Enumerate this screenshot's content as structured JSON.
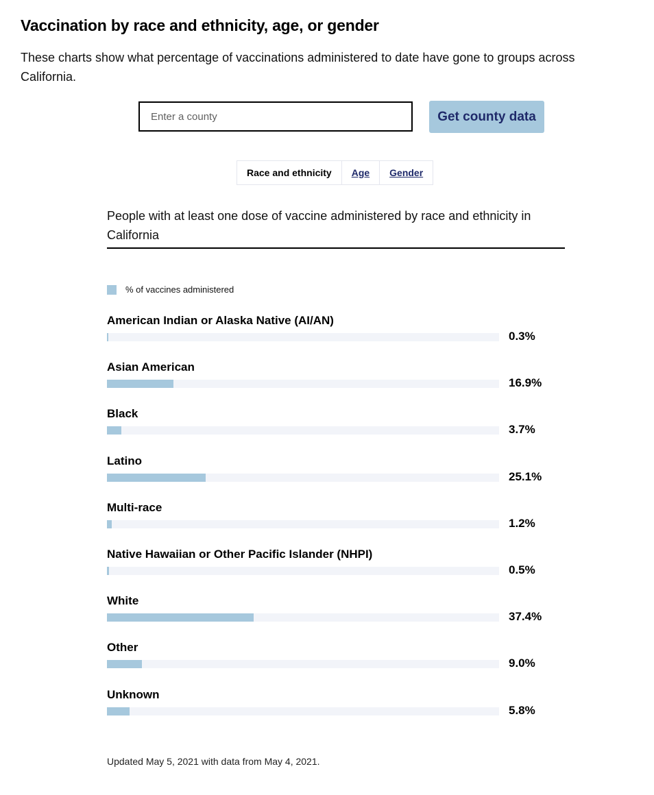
{
  "page": {
    "heading": "Vaccination by race and ethnicity, age, or gender",
    "intro": "These charts show what percentage of vaccinations administered to date have gone to groups across California."
  },
  "search": {
    "placeholder": "Enter a county",
    "value": "",
    "button_label": "Get county data"
  },
  "tabs": [
    {
      "label": "Race and ethnicity",
      "active": true
    },
    {
      "label": "Age",
      "active": false
    },
    {
      "label": "Gender",
      "active": false
    }
  ],
  "colors": {
    "bar": "#a6c8dd",
    "track": "#f2f4f9",
    "button_text": "#1f2a6a"
  },
  "chart_data": {
    "type": "bar",
    "orientation": "horizontal",
    "title": "People with at least one dose of vaccine administered by race and ethnicity in California",
    "legend": [
      "% of vaccines administered"
    ],
    "xlim": [
      0,
      100
    ],
    "unit": "%",
    "categories": [
      "American Indian or Alaska Native (AI/AN)",
      "Asian American",
      "Black",
      "Latino",
      "Multi-race",
      "Native Hawaiian or Other Pacific Islander (NHPI)",
      "White",
      "Other",
      "Unknown"
    ],
    "values": [
      0.3,
      16.9,
      3.7,
      25.1,
      1.2,
      0.5,
      37.4,
      9.0,
      5.8
    ],
    "value_labels": [
      "0.3%",
      "16.9%",
      "3.7%",
      "25.1%",
      "1.2%",
      "0.5%",
      "37.4%",
      "9.0%",
      "5.8%"
    ]
  },
  "footnote": "Updated May 5, 2021 with data from May 4, 2021."
}
